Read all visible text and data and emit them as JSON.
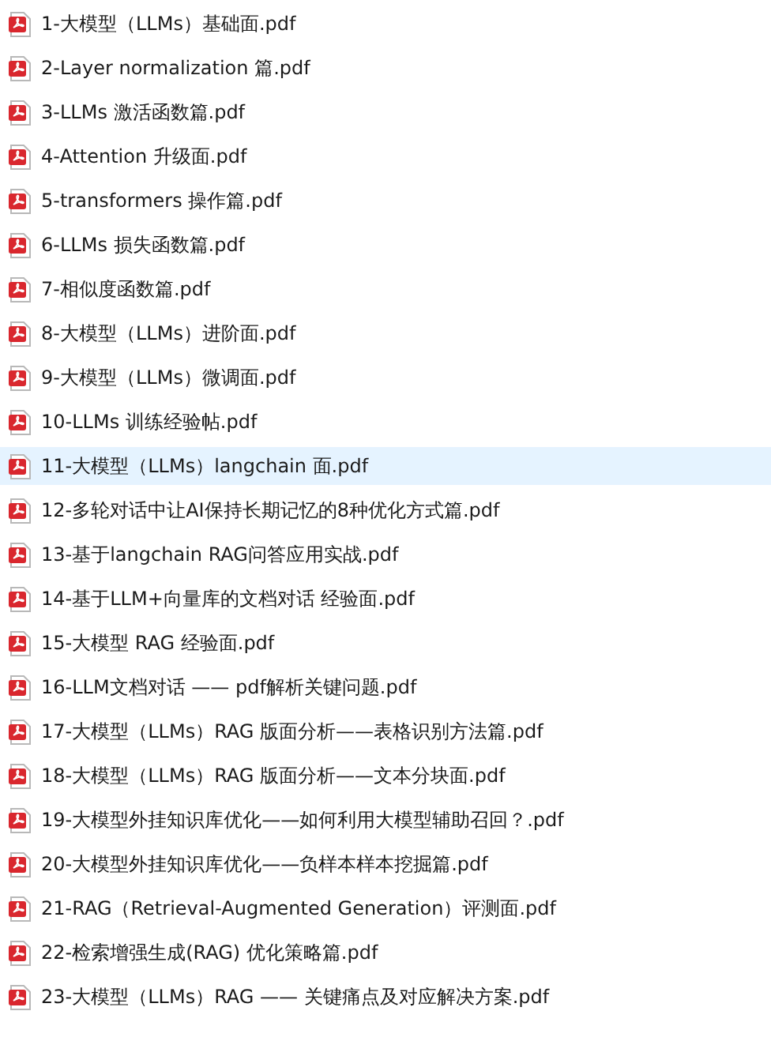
{
  "files": [
    {
      "name": "1-大模型（LLMs）基础面.pdf",
      "selected": false
    },
    {
      "name": "2-Layer normalization 篇.pdf",
      "selected": false
    },
    {
      "name": "3-LLMs 激活函数篇.pdf",
      "selected": false
    },
    {
      "name": "4-Attention 升级面.pdf",
      "selected": false
    },
    {
      "name": "5-transformers 操作篇.pdf",
      "selected": false
    },
    {
      "name": "6-LLMs 损失函数篇.pdf",
      "selected": false
    },
    {
      "name": "7-相似度函数篇.pdf",
      "selected": false
    },
    {
      "name": "8-大模型（LLMs）进阶面.pdf",
      "selected": false
    },
    {
      "name": "9-大模型（LLMs）微调面.pdf",
      "selected": false
    },
    {
      "name": "10-LLMs 训练经验帖.pdf",
      "selected": false
    },
    {
      "name": "11-大模型（LLMs）langchain 面.pdf",
      "selected": true
    },
    {
      "name": "12-多轮对话中让AI保持长期记忆的8种优化方式篇.pdf",
      "selected": false
    },
    {
      "name": "13-基于langchain RAG问答应用实战.pdf",
      "selected": false
    },
    {
      "name": "14-基于LLM+向量库的文档对话 经验面.pdf",
      "selected": false
    },
    {
      "name": "15-大模型 RAG 经验面.pdf",
      "selected": false
    },
    {
      "name": "16-LLM文档对话 —— pdf解析关键问题.pdf",
      "selected": false
    },
    {
      "name": "17-大模型（LLMs）RAG 版面分析——表格识别方法篇.pdf",
      "selected": false
    },
    {
      "name": "18-大模型（LLMs）RAG 版面分析——文本分块面.pdf",
      "selected": false
    },
    {
      "name": "19-大模型外挂知识库优化——如何利用大模型辅助召回？.pdf",
      "selected": false
    },
    {
      "name": "20-大模型外挂知识库优化——负样本样本挖掘篇.pdf",
      "selected": false
    },
    {
      "name": "21-RAG（Retrieval-Augmented Generation）评测面.pdf",
      "selected": false
    },
    {
      "name": "22-检索增强生成(RAG) 优化策略篇.pdf",
      "selected": false
    },
    {
      "name": "23-大模型（LLMs）RAG —— 关键痛点及对应解决方案.pdf",
      "selected": false
    }
  ]
}
